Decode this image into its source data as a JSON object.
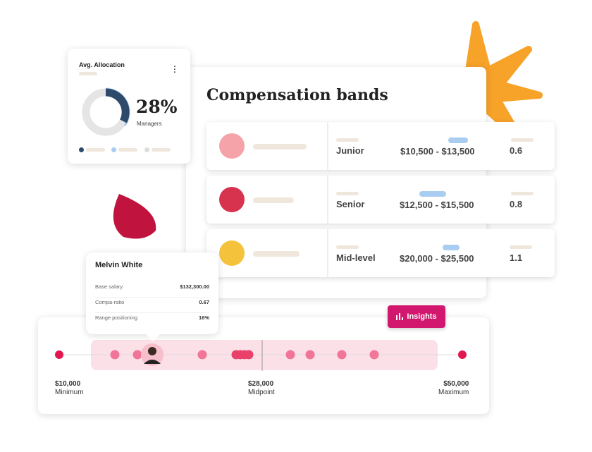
{
  "allocation": {
    "title": "Avg. Allocation",
    "percent": "28%",
    "label": "Managers",
    "colors": {
      "managers": "#2e4a6b",
      "secondary": "#a9cdf0",
      "rest": "#e5e5e5"
    }
  },
  "bands": {
    "title": "Compensation bands",
    "rows": [
      {
        "level": "Junior",
        "range": "$10,500 - $13,500",
        "ratio": "0.6",
        "avatar_color": "#f5a3a8"
      },
      {
        "level": "Senior",
        "range": "$12,500 - $15,500",
        "ratio": "0.8",
        "avatar_color": "#d8334e"
      },
      {
        "level": "Mid-level",
        "range": "$20,000 - $25,500",
        "ratio": "1.1",
        "avatar_color": "#f5c33b"
      }
    ]
  },
  "tooltip": {
    "name": "Melvin White",
    "rows": [
      {
        "label": "Base salary",
        "value": "$132,300.00"
      },
      {
        "label": "Compa-ratio",
        "value": "0.67"
      },
      {
        "label": "Range positioning",
        "value": "16%"
      }
    ]
  },
  "insights": {
    "label": "Insights",
    "icon": "bar-chart-icon",
    "color": "#d2186e"
  },
  "range": {
    "min": {
      "value": "$10,000",
      "label": "Minimum"
    },
    "mid": {
      "value": "$28,000",
      "label": "Midpoint"
    },
    "max": {
      "value": "$50,000",
      "label": "Maximum"
    }
  }
}
